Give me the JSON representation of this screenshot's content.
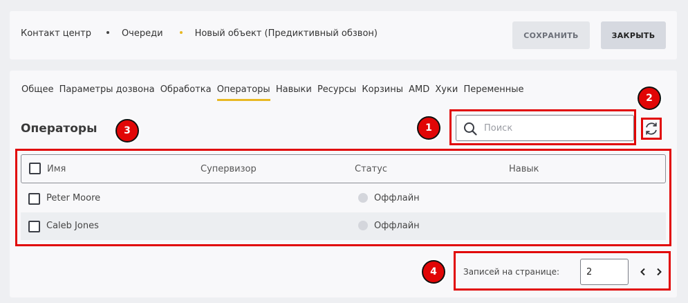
{
  "breadcrumb": [
    "Контакт центр",
    "Очереди",
    "Новый объект (Предиктивный обзвон)"
  ],
  "toolbar": {
    "save_label": "СОХРАНИТЬ",
    "close_label": "ЗАКРЫТЬ"
  },
  "tabs": [
    "Общее",
    "Параметры дозвона",
    "Обработка",
    "Операторы",
    "Навыки",
    "Ресурсы",
    "Корзины",
    "AMD",
    "Хуки",
    "Переменные"
  ],
  "active_tab": "Операторы",
  "section_title": "Операторы",
  "search": {
    "placeholder": "Поиск",
    "value": ""
  },
  "table": {
    "headers": [
      "Имя",
      "Супервизор",
      "Статус",
      "Навык"
    ],
    "rows": [
      {
        "name": "Peter Moore",
        "supervisor": "",
        "status": "Оффлайн",
        "skill": ""
      },
      {
        "name": "Caleb Jones",
        "supervisor": "",
        "status": "Оффлайн",
        "skill": ""
      }
    ]
  },
  "pager": {
    "label": "Записей на странице:",
    "value": "2"
  },
  "badges": [
    "1",
    "2",
    "3",
    "4"
  ],
  "colors": {
    "accent": "#e8b823",
    "highlight": "#e10606",
    "badge": "#e10606"
  },
  "icons": [
    "search-icon",
    "refresh-icon",
    "chevron-left-icon",
    "chevron-right-icon",
    "checkbox-icon",
    "status-dot-icon"
  ]
}
